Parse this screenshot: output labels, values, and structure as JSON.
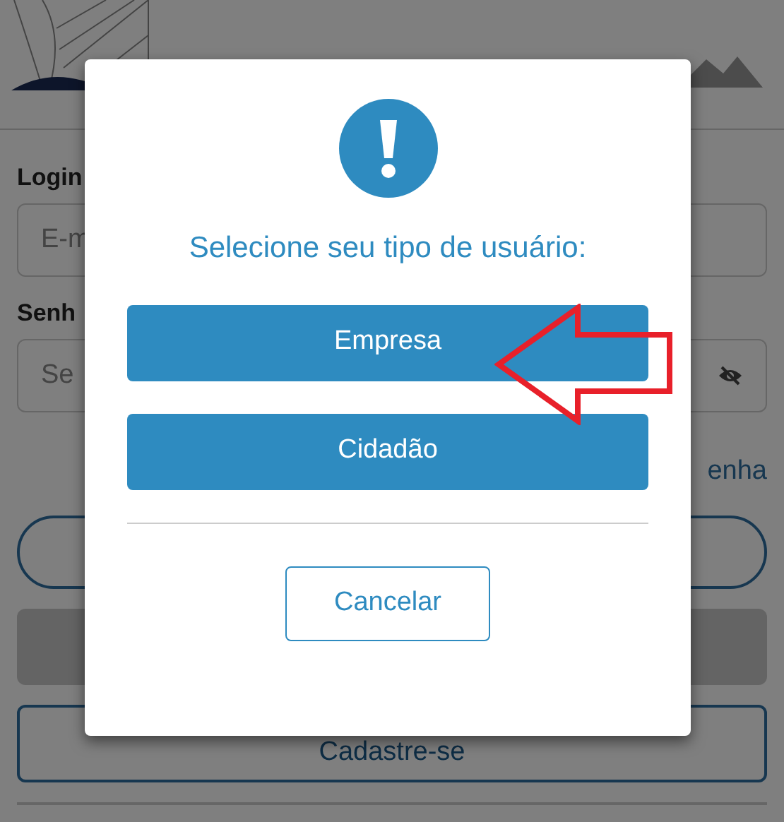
{
  "background_form": {
    "login_label": "Login",
    "email_placeholder": "E-m",
    "password_label": "Senh",
    "password_placeholder": "Se",
    "forgot_link": "enha",
    "signup_button": "Cadastre-se"
  },
  "dialog": {
    "title": "Selecione seu tipo de usuário:",
    "options": [
      "Empresa",
      "Cidadão"
    ],
    "cancel_button": "Cancelar"
  }
}
